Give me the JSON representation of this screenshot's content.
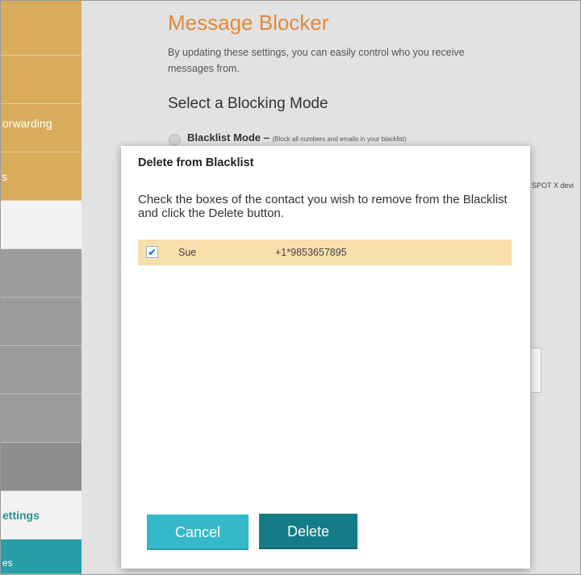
{
  "sidebar": {
    "items": [
      {
        "label": ""
      },
      {
        "label": ""
      },
      {
        "label": "orwarding"
      },
      {
        "label": "s"
      },
      {
        "label": ""
      },
      {
        "label": ""
      },
      {
        "label": ""
      },
      {
        "label": ""
      },
      {
        "label": ""
      },
      {
        "label": ""
      },
      {
        "label": "ettings"
      },
      {
        "label": "es"
      }
    ]
  },
  "page": {
    "title": "Message Blocker",
    "description": "By updating these settings, you can easily control who you receive messages from.",
    "section_title": "Select a Blocking Mode",
    "blacklist_mode": {
      "label": "Blacklist Mode –",
      "hint": "(Block all numbers and emails in your blacklist)"
    },
    "cut_off_text": "SPOT X devi"
  },
  "modal": {
    "title": "Delete from Blacklist",
    "instructions": "Check the boxes of the contact you wish to remove from the Blacklist and click the Delete button.",
    "contacts": [
      {
        "name": "Sue",
        "phone": "+1*9853657895",
        "checked": true,
        "check_glyph": "✔"
      }
    ],
    "cancel_label": "Cancel",
    "delete_label": "Delete"
  },
  "colors": {
    "accent_orange": "#e08a3c",
    "sidebar_gold": "#d9ac5c",
    "row_highlight": "#f8dfae",
    "cancel_button": "#35b8c9",
    "delete_button": "#137c87",
    "sidebar_teal": "#2a9ea8"
  }
}
